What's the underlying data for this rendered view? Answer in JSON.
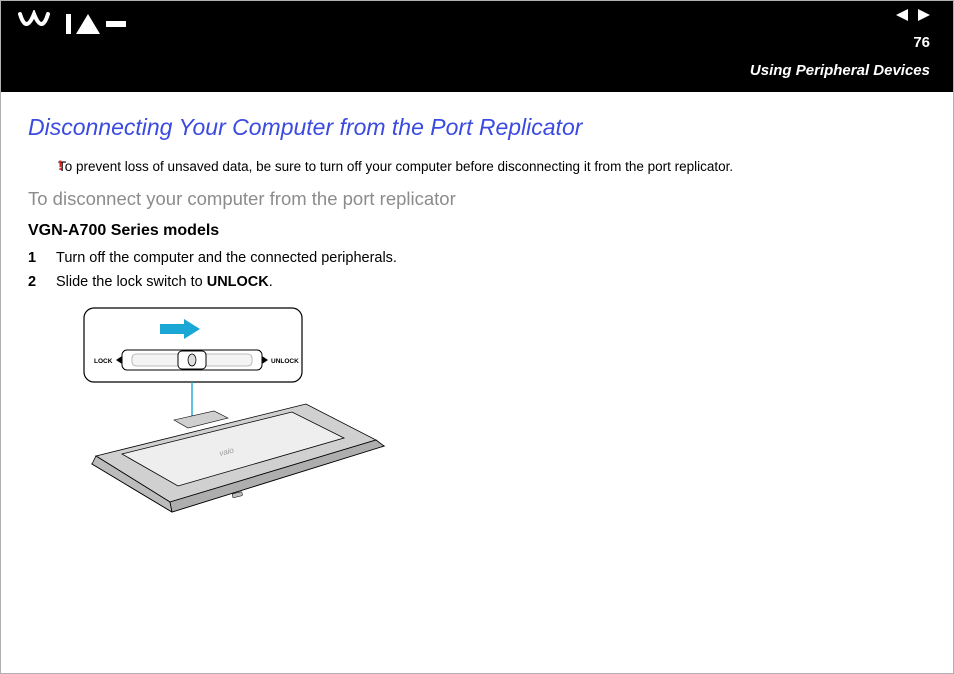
{
  "header": {
    "page_number": "76",
    "section": "Using Peripheral Devices"
  },
  "content": {
    "heading": "Disconnecting Your Computer from the Port Replicator",
    "warning_mark": "!",
    "warning_text": "To prevent loss of unsaved data, be sure to turn off your computer before disconnecting it from the port replicator.",
    "subheading": "To disconnect your computer from the port replicator",
    "series_title": "VGN-A700 Series models",
    "steps": [
      {
        "num": "1",
        "text": "Turn off the computer and the connected peripherals."
      },
      {
        "num": "2",
        "prefix": "Slide the lock switch to ",
        "bold": "UNLOCK",
        "suffix": "."
      }
    ],
    "diagram": {
      "lock_label": "LOCK",
      "unlock_label": "UNLOCK"
    }
  }
}
